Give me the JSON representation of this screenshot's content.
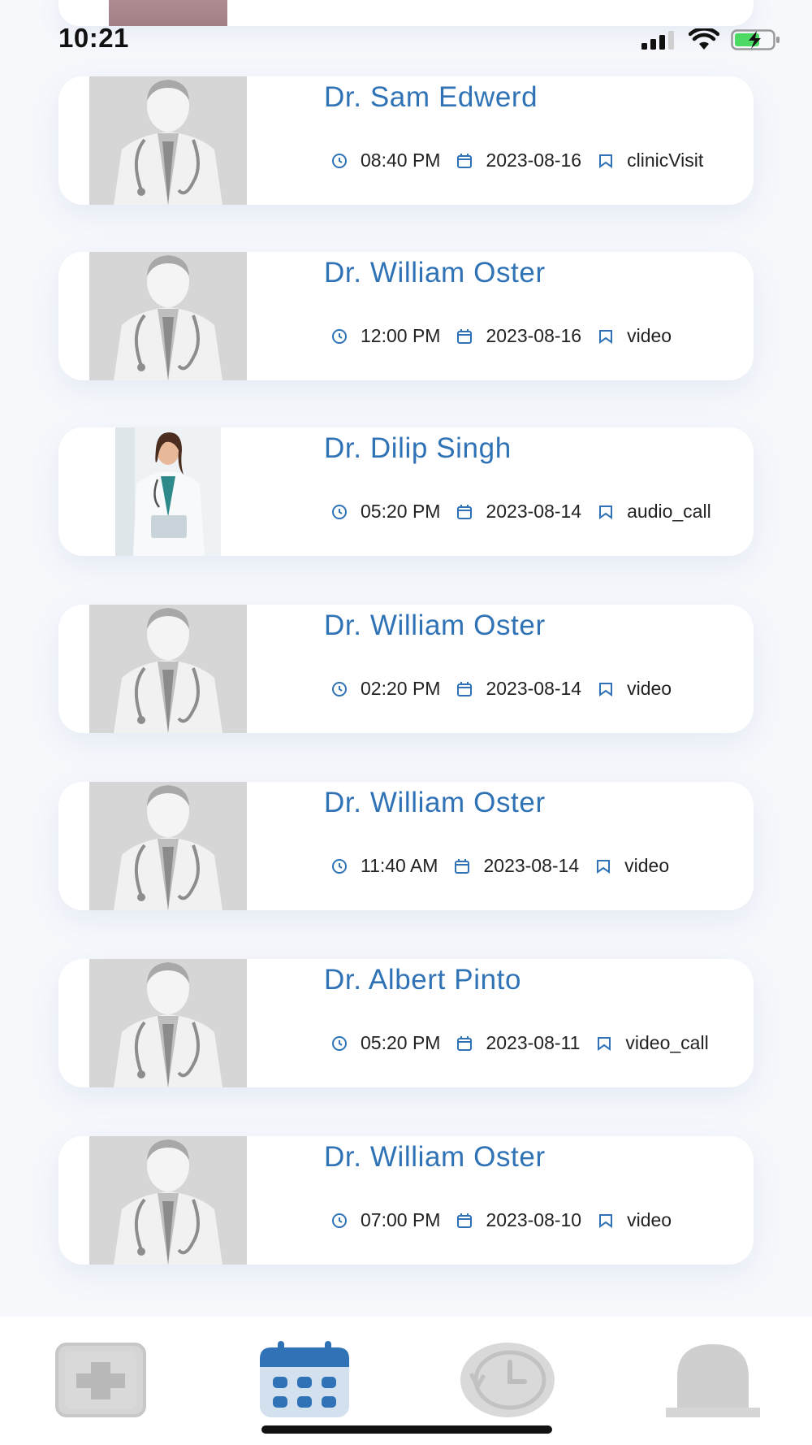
{
  "status_bar": {
    "time": "10:21"
  },
  "appointments": [
    {
      "doctor": "Dr. Sam Edwerd",
      "time": "08:40 PM",
      "date": "2023-08-16",
      "type": "clinicVisit",
      "photo": "placeholder"
    },
    {
      "doctor": "Dr. William Oster",
      "time": "12:00 PM",
      "date": "2023-08-16",
      "type": "video",
      "photo": "placeholder"
    },
    {
      "doctor": "Dr. Dilip Singh",
      "time": "05:20 PM",
      "date": "2023-08-14",
      "type": "audio_call",
      "photo": "real"
    },
    {
      "doctor": "Dr. William Oster",
      "time": "02:20 PM",
      "date": "2023-08-14",
      "type": "video",
      "photo": "placeholder"
    },
    {
      "doctor": "Dr. William Oster",
      "time": "11:40 AM",
      "date": "2023-08-14",
      "type": "video",
      "photo": "placeholder"
    },
    {
      "doctor": "Dr. Albert Pinto",
      "time": "05:20 PM",
      "date": "2023-08-11",
      "type": "video_call",
      "photo": "placeholder"
    },
    {
      "doctor": "Dr. William Oster",
      "time": "07:00 PM",
      "date": "2023-08-10",
      "type": "video",
      "photo": "placeholder"
    }
  ],
  "icons": {
    "time": "clock-icon",
    "date": "calendar-icon",
    "type": "bookmark-icon"
  },
  "bottom_nav": [
    {
      "name": "medical-plus-icon",
      "active": false
    },
    {
      "name": "calendar-grid-icon",
      "active": true
    },
    {
      "name": "history-clock-icon",
      "active": false
    },
    {
      "name": "bell-icon",
      "active": false
    }
  ],
  "colors": {
    "accent": "#2f73b6",
    "inactive": "#d3d3d3",
    "background": "#f6f8fc"
  }
}
